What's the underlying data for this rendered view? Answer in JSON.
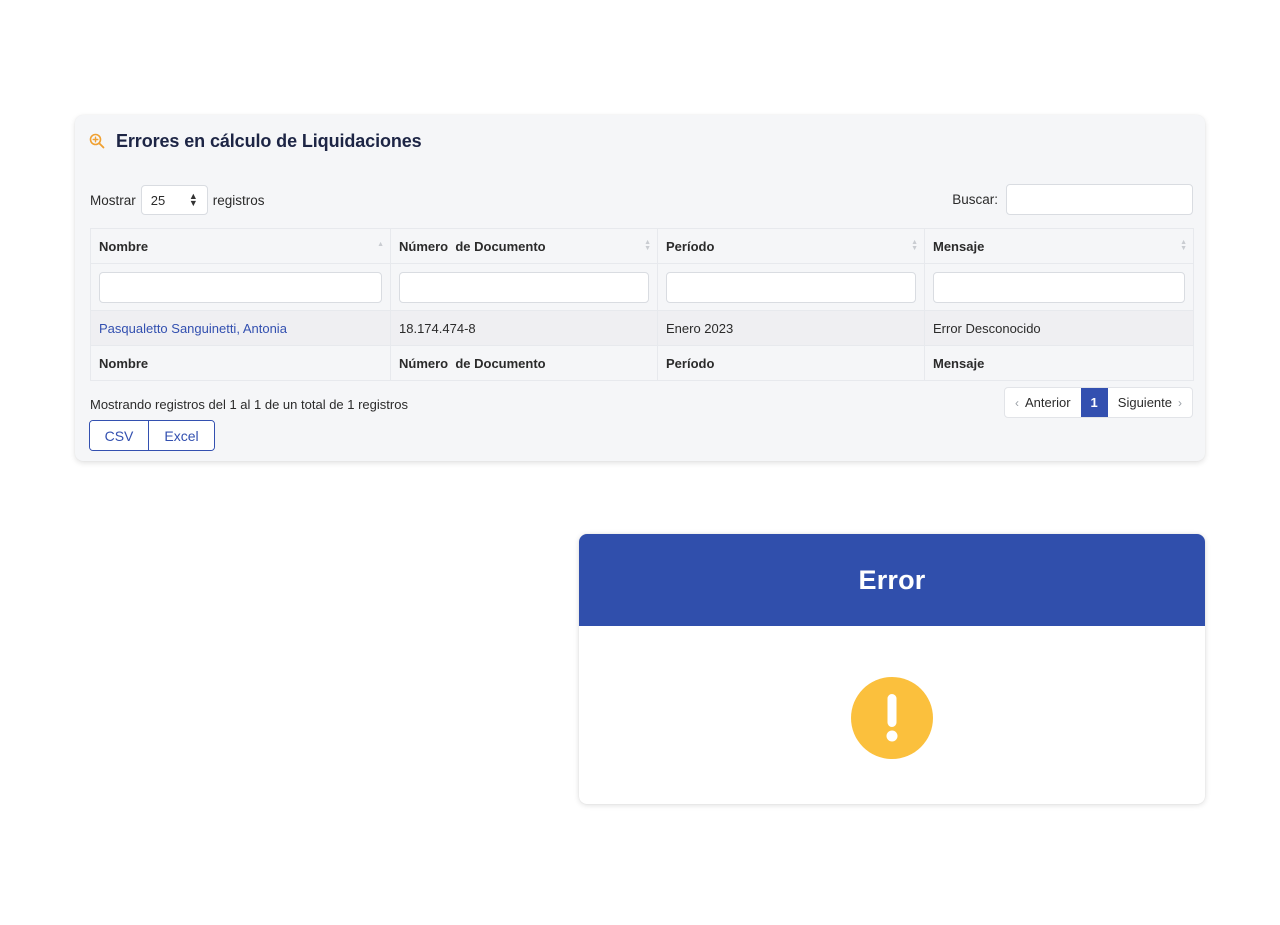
{
  "card": {
    "title": "Errores en cálculo de Liquidaciones",
    "title_icon": "zoom-in-icon",
    "length": {
      "prefix": "Mostrar",
      "value": "25",
      "suffix": "registros"
    },
    "search": {
      "label": "Buscar:",
      "value": ""
    },
    "table": {
      "columns": [
        "Nombre",
        "Número  de Documento",
        "Período",
        "Mensaje"
      ],
      "rows": [
        [
          "Pasqualetto Sanguinetti, Antonia",
          "18.174.474-8",
          "Enero 2023",
          "Error Desconocido"
        ]
      ],
      "footer": [
        "Nombre",
        "Número  de Documento",
        "Período",
        "Mensaje"
      ]
    },
    "info": "Mostrando registros del 1 al 1 de un total de 1 registros",
    "pagination": {
      "previous": "Anterior",
      "current": "1",
      "next": "Siguiente"
    },
    "export_buttons": {
      "csv": "CSV",
      "excel": "Excel"
    },
    "colors": {
      "accent": "#3350b0",
      "icon": "#f0a030",
      "title": "#1d2545"
    }
  },
  "modal": {
    "title": "Error",
    "icon": "warning-icon",
    "colors": {
      "header": "#304fac",
      "icon": "#fbc03d"
    }
  }
}
